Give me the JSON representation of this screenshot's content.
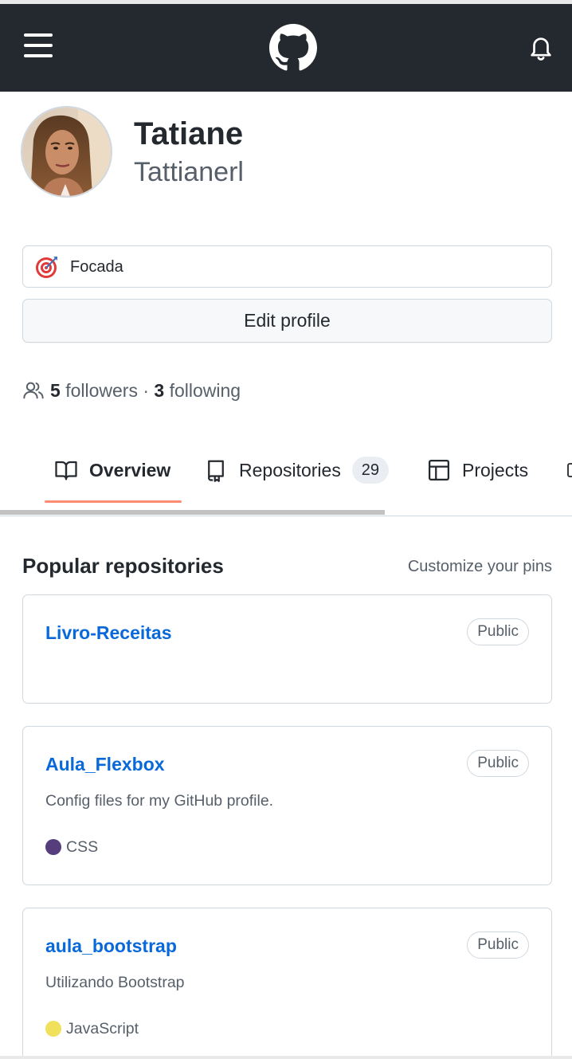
{
  "header": {
    "menu_icon": "hamburger-menu-icon",
    "logo_icon": "github-octocat-icon",
    "notification_icon": "bell-icon"
  },
  "profile": {
    "name": "Tatiane",
    "login": "Tattianerl",
    "avatar": "user-photo-avatar"
  },
  "status": {
    "emoji_icon": "direct-hit-target-icon",
    "text": "Focada"
  },
  "edit_profile_label": "Edit profile",
  "social": {
    "people_icon": "people-icon",
    "followers_count": "5",
    "followers_label": "followers",
    "separator": "·",
    "following_count": "3",
    "following_label": "following"
  },
  "tabs": [
    {
      "label": "Overview",
      "icon": "book-icon",
      "selected": true
    },
    {
      "label": "Repositories",
      "icon": "repo-icon",
      "count": "29"
    },
    {
      "label": "Projects",
      "icon": "table-icon"
    }
  ],
  "popular": {
    "title": "Popular repositories",
    "customize_label": "Customize your pins",
    "repos": [
      {
        "name": "Livro-Receitas",
        "visibility": "Public",
        "description": "",
        "language": "",
        "language_color": ""
      },
      {
        "name": "Aula_Flexbox",
        "visibility": "Public",
        "description": "Config files for my GitHub profile.",
        "language": "CSS",
        "language_color": "#563d7c"
      },
      {
        "name": "aula_bootstrap",
        "visibility": "Public",
        "description": "Utilizando Bootstrap",
        "language": "JavaScript",
        "language_color": "#f1e05a"
      }
    ]
  },
  "colors": {
    "header_bg": "#24292f",
    "link": "#0969da",
    "tab_underline": "#fd8c73",
    "muted": "#57606a"
  }
}
